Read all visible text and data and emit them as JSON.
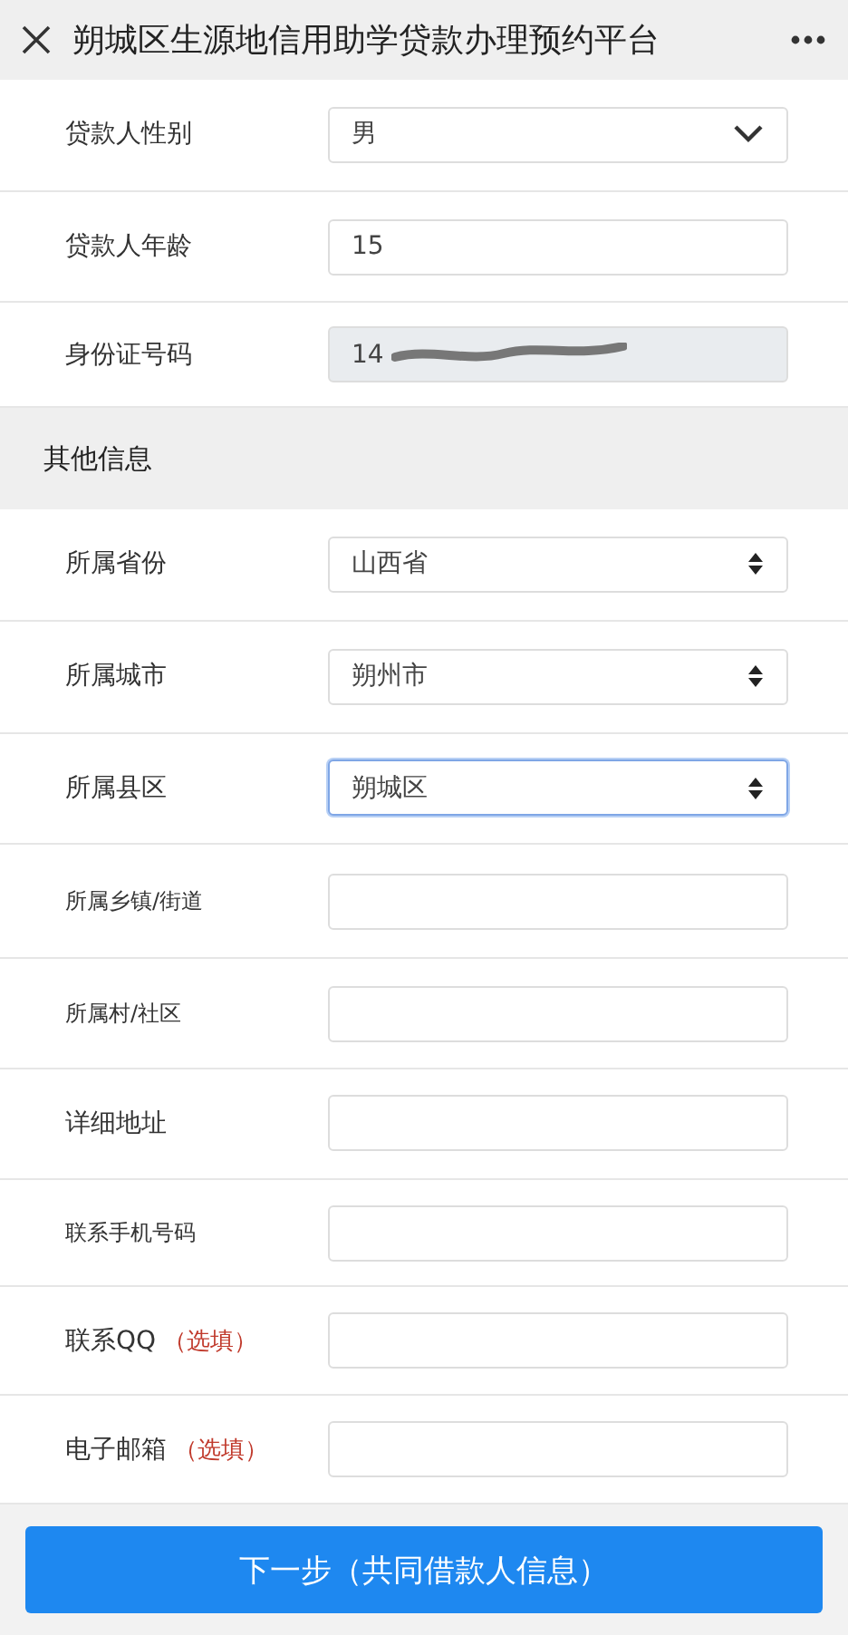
{
  "header": {
    "title": "朔城区生源地信用助学贷款办理预约平台"
  },
  "fields": [
    {
      "label": "贷款人性别",
      "kind": "dropdown",
      "value": "男",
      "focused": false
    },
    {
      "label": "贷款人年龄",
      "kind": "text",
      "value": "15",
      "focused": false
    },
    {
      "label": "身份证号码",
      "kind": "readonly",
      "value": "14",
      "focused": false
    }
  ],
  "section": {
    "title": "其他信息"
  },
  "other_fields": [
    {
      "label": "所属省份",
      "kind": "select",
      "value": "山西省",
      "focused": false
    },
    {
      "label": "所属城市",
      "kind": "select",
      "value": "朔州市",
      "focused": false
    },
    {
      "label": "所属县区",
      "kind": "select",
      "value": "朔城区",
      "focused": true
    },
    {
      "label": "所属乡镇/街道",
      "kind": "text",
      "focused": false
    },
    {
      "label": "所属村/社区",
      "kind": "text",
      "focused": false
    },
    {
      "label": "详细地址",
      "kind": "text",
      "focused": false
    },
    {
      "label": "联系手机号码",
      "kind": "text",
      "focused": false
    },
    {
      "label": "联系QQ",
      "note": "（选填）",
      "kind": "text",
      "focused": false
    },
    {
      "label": "电子邮箱",
      "note": "（选填）",
      "kind": "text",
      "focused": false
    }
  ],
  "next_button": "下一步（共同借款人信息）"
}
